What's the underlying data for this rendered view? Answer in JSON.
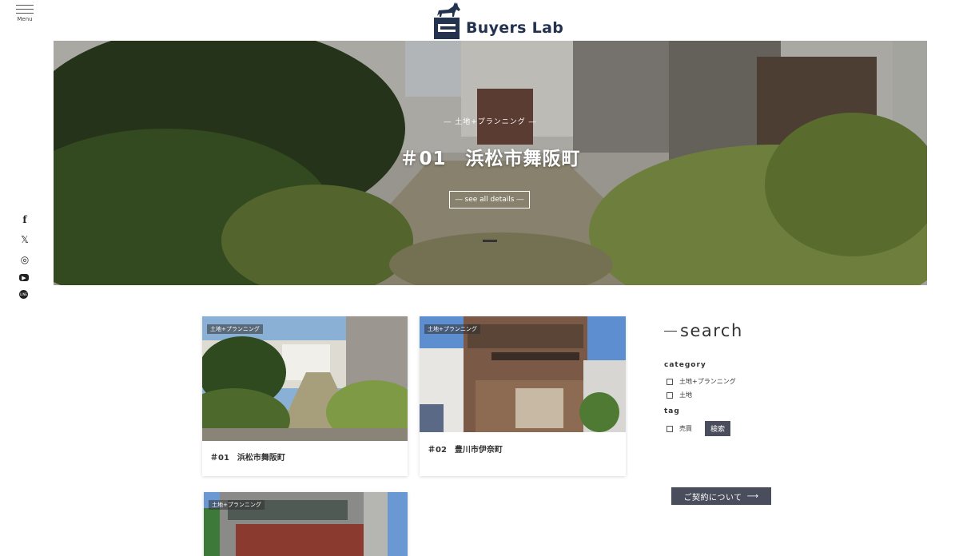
{
  "header": {
    "menu_label": "Menu",
    "logo_text": "Buyers Lab"
  },
  "hero": {
    "category": "― 土地+プランニング ―",
    "title": "＃01　浜松市舞阪町",
    "button_label": "― see all details ―"
  },
  "social": [
    {
      "name": "facebook-icon",
      "glyph": "f"
    },
    {
      "name": "x-icon",
      "glyph": "𝕏"
    },
    {
      "name": "instagram-icon",
      "glyph": "◎"
    },
    {
      "name": "youtube-icon",
      "glyph": "▶"
    },
    {
      "name": "line-icon",
      "glyph": "LINE"
    }
  ],
  "cards": [
    {
      "tag": "土地+プランニング",
      "title": "＃01　浜松市舞阪町"
    },
    {
      "tag": "土地+プランニング",
      "title": "＃02　豊川市伊奈町"
    },
    {
      "tag": "土地+プランニング",
      "title": ""
    }
  ],
  "sidebar": {
    "heading": "search",
    "category_label": "category",
    "categories": [
      "土地+プランニング",
      "土地"
    ],
    "tag_label": "tag",
    "tags": [
      "売買"
    ],
    "search_button": "検索"
  },
  "contract_button": {
    "label": "ご契約について",
    "arrow": "⟶"
  }
}
